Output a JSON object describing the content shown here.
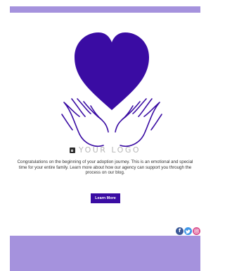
{
  "brand": {
    "logo_text": "YOUR LOGO"
  },
  "body": {
    "message": "Congratulations on the beginning of your adoption journey. This is an emotional and special time for your entire family. Learn more about how our agency can support you through the process on our blog."
  },
  "cta": {
    "label": "Learn More"
  },
  "social": {
    "items": [
      {
        "name": "facebook",
        "icon": "facebook-icon"
      },
      {
        "name": "twitter",
        "icon": "twitter-icon"
      },
      {
        "name": "instagram",
        "icon": "instagram-icon"
      }
    ]
  },
  "colors": {
    "accent": "#3a0ca3",
    "banner": "#a592dd",
    "text": "#333333",
    "logo_text": "#b7b7b7"
  }
}
